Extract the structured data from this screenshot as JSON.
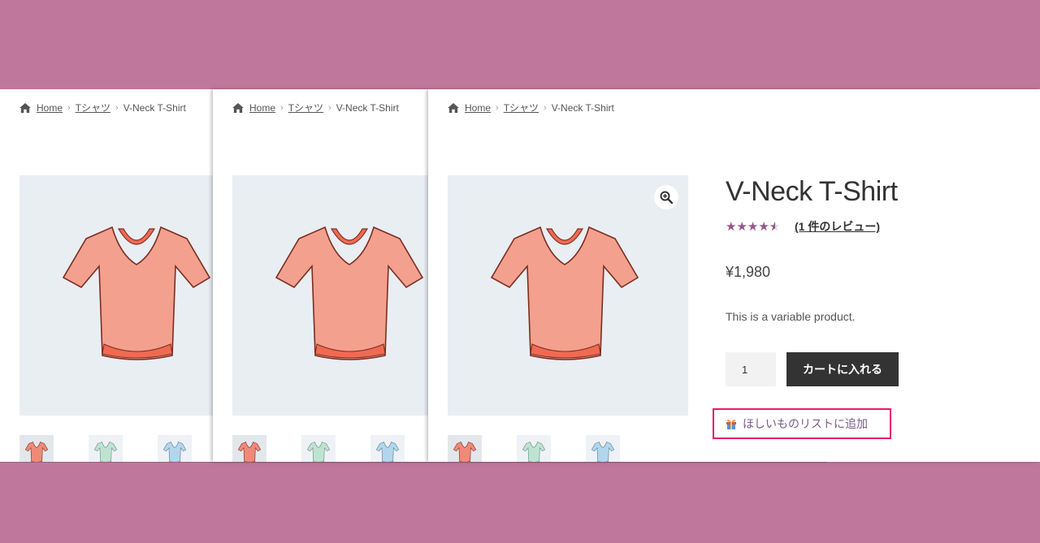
{
  "breadcrumb": {
    "home_label": "Home",
    "category_label": "Tシャツ",
    "current_label": "V-Neck T-Shirt",
    "separator": "›"
  },
  "product": {
    "title": "V-Neck T-Shirt",
    "rating_fraction": 0.8,
    "stars_glyphs": "★★★★★",
    "review_link": "(1 件のレビュー)",
    "price": "¥1,980",
    "description": "This is a variable product.",
    "quantity": "1",
    "add_to_cart_label": "カートに入れる",
    "wishlist_label": "ほしいものリストに追加"
  },
  "gallery": {
    "thumbnails": [
      "coral",
      "mint",
      "light-blue"
    ],
    "zoom_icon": "zoom-in-icon"
  },
  "colors": {
    "background": "#c0779c",
    "star": "#96588a",
    "wishlist_border": "#e8196a",
    "button": "#333333",
    "shirt_coral": "#f08a78",
    "shirt_mint": "#bfe3d3",
    "shirt_blue": "#b3d6ef"
  }
}
